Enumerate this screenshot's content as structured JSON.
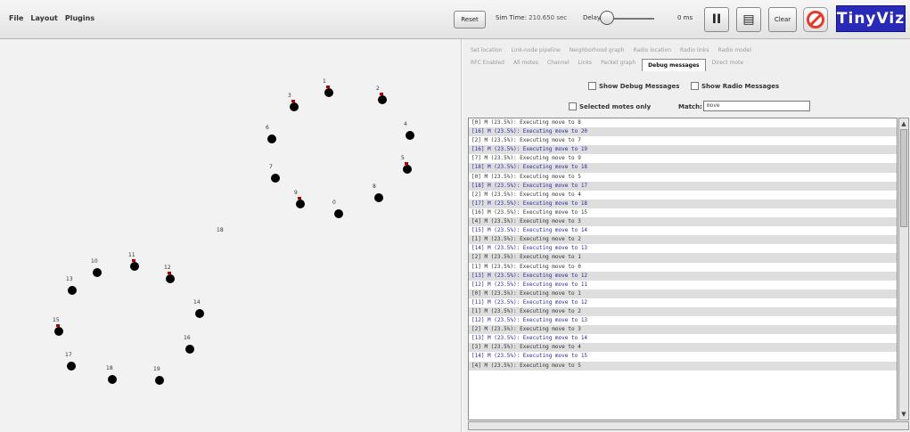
{
  "menu": [
    "File",
    "Layout",
    "Plugins"
  ],
  "toolbar": {
    "reset_label": "Reset",
    "simtime_label": "Sim Time:",
    "simtime_value": "210.650 sec",
    "delay_label": "Delay:",
    "delay_value": "0 ms",
    "play_pause_label": "II",
    "grid_label": "▤",
    "clear_label": "Clear",
    "stop_icon": "stop-circle-icon",
    "logo": "TinyViz"
  },
  "tabs": {
    "row1": [
      "Set location",
      "Link-node pipeline",
      "Neighborhood graph",
      "Radio location",
      "Radio links",
      "Radio model"
    ],
    "row2": [
      "RFC Enabled",
      "All motes",
      "Channel",
      "Links",
      "Packet graph",
      "Debug messages",
      "Direct mote"
    ],
    "active": "Debug messages"
  },
  "options": {
    "show_debug": "Show Debug Messages",
    "show_radio": "Show Radio Messages",
    "selected_only": "Selected motes only",
    "match_label": "Match:",
    "match_value": "move"
  },
  "log": [
    {
      "text": "[0] M (23.5%): Executing move to 8",
      "blue": false
    },
    {
      "text": "[16] M (23.5%): Executing move to 20",
      "blue": true
    },
    {
      "text": "[2] M (23.5%): Executing move to 7",
      "blue": false
    },
    {
      "text": "[16] M (23.5%): Executing move to 19",
      "blue": true
    },
    {
      "text": "[7] M (23.5%): Executing move to 9",
      "blue": false
    },
    {
      "text": "[18] M (23.5%): Executing move to 18",
      "blue": true
    },
    {
      "text": "[0] M (23.5%): Executing move to 5",
      "blue": false
    },
    {
      "text": "[18] M (23.5%): Executing move to 17",
      "blue": true
    },
    {
      "text": "[2] M (23.5%): Executing move to 4",
      "blue": false
    },
    {
      "text": "[17] M (23.5%): Executing move to 18",
      "blue": true
    },
    {
      "text": "[16] M (23.5%): Executing move to 15",
      "blue": false
    },
    {
      "text": "[4] M (23.5%): Executing move to 3",
      "blue": false
    },
    {
      "text": "[15] M (23.5%): Executing move to 14",
      "blue": true
    },
    {
      "text": "[1] M (23.5%): Executing move to 2",
      "blue": false
    },
    {
      "text": "[14] M (23.5%): Executing move to 13",
      "blue": true
    },
    {
      "text": "[2] M (23.5%): Executing move to 1",
      "blue": false
    },
    {
      "text": "[1] M (23.5%): Executing move to 0",
      "blue": false
    },
    {
      "text": "[13] M (23.5%): Executing move to 12",
      "blue": true
    },
    {
      "text": "[12] M (23.5%): Executing move to 11",
      "blue": true
    },
    {
      "text": "[0] M (23.5%): Executing move to 1",
      "blue": false
    },
    {
      "text": "[11] M (23.5%): Executing move to 12",
      "blue": true
    },
    {
      "text": "[1] M (23.5%): Executing move to 2",
      "blue": false
    },
    {
      "text": "[12] M (23.5%): Executing move to 13",
      "blue": true
    },
    {
      "text": "[2] M (23.5%): Executing move to 3",
      "blue": false
    },
    {
      "text": "[13] M (23.5%): Executing move to 14",
      "blue": true
    },
    {
      "text": "[3] M (23.5%): Executing move to 4",
      "blue": false
    },
    {
      "text": "[14] M (23.5%): Executing move to 15",
      "blue": true
    },
    {
      "text": "[4] M (23.5%): Executing move to 5",
      "blue": false
    }
  ],
  "motes": [
    {
      "id": "1",
      "red": true
    },
    {
      "id": "2",
      "red": true
    },
    {
      "id": "3",
      "red": true
    },
    {
      "id": "4",
      "red": false
    },
    {
      "id": "5",
      "red": true
    },
    {
      "id": "6",
      "red": false
    },
    {
      "id": "7",
      "red": false
    },
    {
      "id": "8",
      "red": false
    },
    {
      "id": "9",
      "red": true
    },
    {
      "id": "0",
      "red": false
    },
    {
      "id": "10",
      "red": false
    },
    {
      "id": "11",
      "red": true
    },
    {
      "id": "12",
      "red": true
    },
    {
      "id": "13",
      "red": false
    },
    {
      "id": "14",
      "red": false
    },
    {
      "id": "15",
      "red": true
    },
    {
      "id": "16",
      "red": false
    },
    {
      "id": "17",
      "red": false
    },
    {
      "id": "18",
      "red": false
    },
    {
      "id": "19",
      "red": false
    }
  ],
  "stray_label": "18"
}
